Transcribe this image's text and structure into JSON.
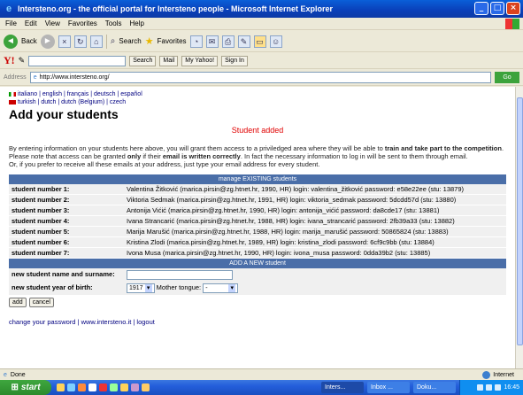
{
  "window": {
    "title": "Intersteno.org - the official portal for Intersteno people - Microsoft Internet Explorer"
  },
  "menu": [
    "File",
    "Edit",
    "View",
    "Favorites",
    "Tools",
    "Help"
  ],
  "toolbar": {
    "back": "Back",
    "search": "Search",
    "favorites": "Favorites"
  },
  "yahoo_bar": {
    "logo": "Y!",
    "search_btn": "Search",
    "mail": "Mail",
    "my_yahoo": "My Yahoo!",
    "signin": "Sign In"
  },
  "address": {
    "label": "Address",
    "url": "http://www.intersteno.org/",
    "go": "Go"
  },
  "languages": {
    "line1": "italiano | english | français | deutsch | español",
    "line2": "turkish | dutch | dutch (Belgium) | czech"
  },
  "page": {
    "title": "Add your students",
    "status_msg": "Student added",
    "intro_1a": "By entering information on your students here above, you will grant them access to a priviledged area where they will be able to ",
    "intro_1b": "train and take part to the competition",
    "intro_1c": ".",
    "intro_2a": "Please note that access can be granted ",
    "intro_2b": "only",
    "intro_2c": " if their ",
    "intro_2d": "email is written correctly",
    "intro_2e": ". In fact the necessary information to log in will be sent to them through email.",
    "intro_3": "Or, if you prefer to receive all these emails at your address, just type your email address for every student."
  },
  "students_header": "manage EXISTING students",
  "students": [
    {
      "label": "student number 1:",
      "info": "Valentina Žitković (marica.pirsin@zg.htnet.hr, 1990, HR) login: valentina_žitković password: e58e22ee (stu: 13879)"
    },
    {
      "label": "student number 2:",
      "info": "Viktoria Sedmak (marica.pirsin@zg.htnet.hr, 1991, HR) login: viktoria_sedmak password: 5dcdd57d (stu: 13880)"
    },
    {
      "label": "student number 3:",
      "info": "Antonija Vićić (marica.pirsin@zg.htnet.hr, 1990, HR) login: antonija_vićić password: da8cde17 (stu: 13881)"
    },
    {
      "label": "student number 4:",
      "info": "Ivana Strancarić (marica.pirsin@zg.htnet.hr, 1988, HR) login: ivana_strancarić password: 2fb39a33 (stu: 13882)"
    },
    {
      "label": "student number 5:",
      "info": "Marija Marušić (marica.pirsin@zg.htnet.hr, 1988, HR) login: marija_marušić password: 50865824 (stu: 13883)"
    },
    {
      "label": "student number 6:",
      "info": "Kristina Zlodi (marica.pirsin@zg.htnet.hr, 1989, HR) login: kristina_zlodi password: 6cf9c9bb (stu: 13884)"
    },
    {
      "label": "student number 7:",
      "info": "Ivona Musa (marica.pirsin@zg.htnet.hr, 1990, HR) login: ivona_musa password: 0dda39b2 (stu: 13885)"
    }
  ],
  "new_student": {
    "header": "ADD A NEW student",
    "name_label": "new student name and surname:",
    "year_label": "new student year of birth:",
    "year_value": "1917",
    "tongue_label": "Mother tongue:",
    "tongue_value": "-",
    "add_btn": "add",
    "cancel_btn": "cancel"
  },
  "footer": {
    "change_pw": "change your password",
    "site": "www.intersteno.it",
    "logout": "logout"
  },
  "status": {
    "left": "Done",
    "zone": "Internet"
  },
  "taskbar": {
    "start": "start",
    "tasks": [
      "Inters...",
      "Inbox ...",
      "Doku..."
    ],
    "clock": "16:45"
  }
}
